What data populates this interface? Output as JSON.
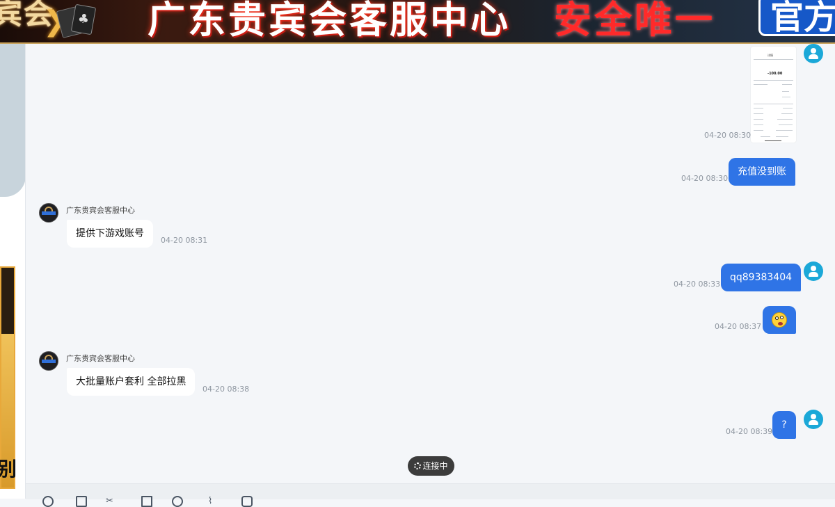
{
  "banner": {
    "left_text": "宾会",
    "title": "广东贵宾会客服中心",
    "safe_text": "安全唯一",
    "official_text": "官方",
    "colors": {
      "accent": "#c9a25a",
      "title_glow": "#ff3a20",
      "safe": "#ff2a2a",
      "official_bg": "#1658c8"
    }
  },
  "left_ad": {
    "glyph": "别"
  },
  "chat": {
    "bubble_out_color": "#2f74e6",
    "bubble_in_color": "#ffffff",
    "messages": [
      {
        "type": "image",
        "direction": "out",
        "time": "04-20 08:30",
        "thumb": {
          "header": "详情",
          "amount": "-100.00"
        }
      },
      {
        "type": "text",
        "direction": "out",
        "text": "充值没到账",
        "time": "04-20 08:30"
      },
      {
        "type": "text",
        "direction": "in",
        "sender": "广东贵宾会客服中心",
        "text": "提供下游戏账号",
        "time": "04-20 08:31"
      },
      {
        "type": "text",
        "direction": "out",
        "text": "qq89383404",
        "time": "04-20 08:33"
      },
      {
        "type": "emoji",
        "direction": "out",
        "emoji": "dizzy-face-emoji",
        "time": "04-20 08:37"
      },
      {
        "type": "text",
        "direction": "in",
        "sender": "广东贵宾会客服中心",
        "text": "大批量账户套利 全部拉黑",
        "time": "04-20 08:38"
      },
      {
        "type": "text",
        "direction": "out",
        "text": "?",
        "time": "04-20 08:39"
      }
    ]
  },
  "status": {
    "label": "连接中",
    "icon": "spinner-icon"
  },
  "toolbar": {
    "icons": [
      "emoji-icon",
      "image-icon",
      "scissors-icon",
      "file-icon",
      "history-icon",
      "attachment-icon",
      "rating-icon"
    ]
  }
}
